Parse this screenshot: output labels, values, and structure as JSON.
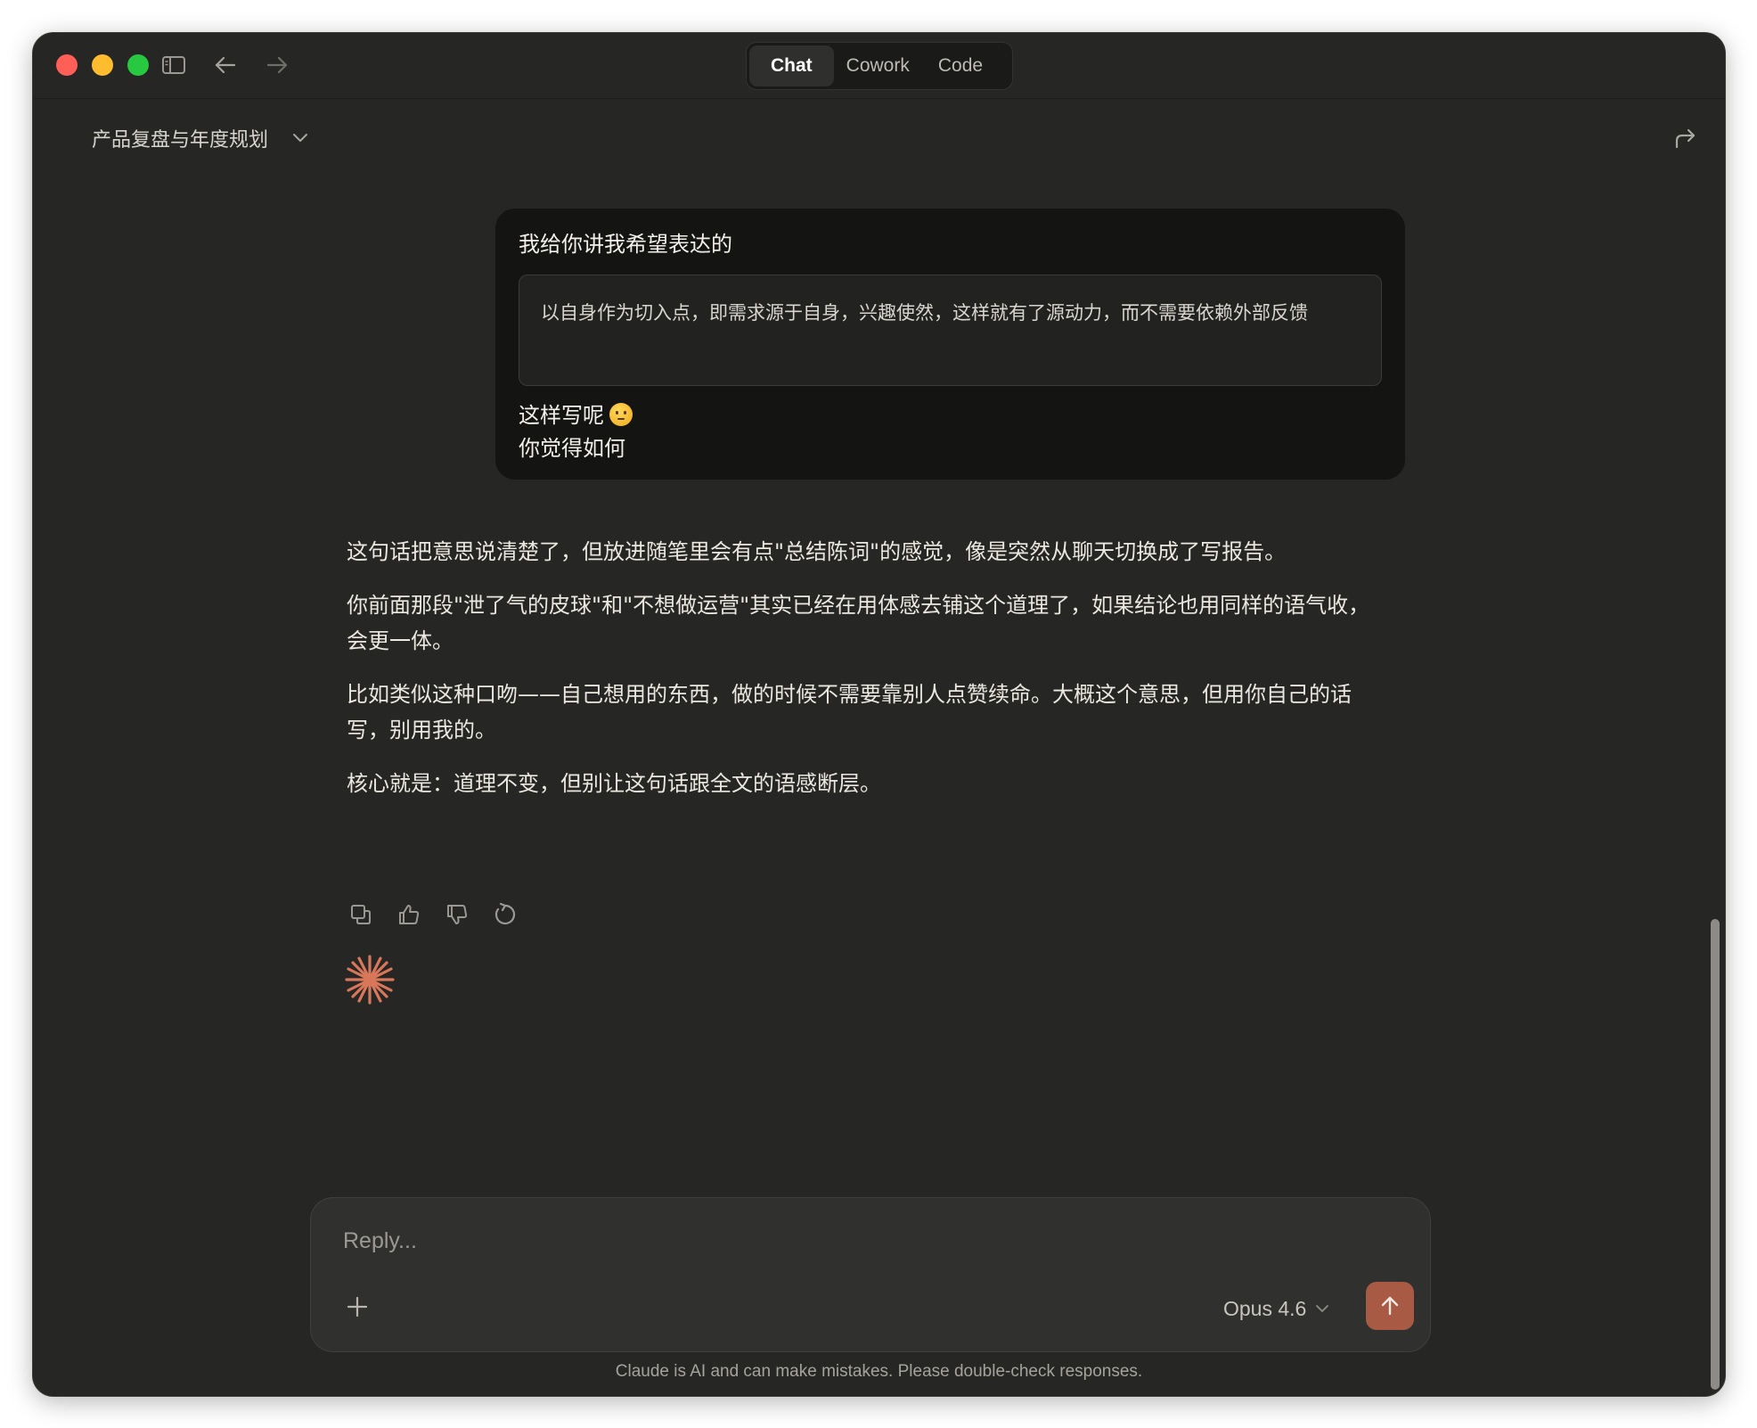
{
  "window": {
    "tabs": [
      {
        "label": "Chat",
        "active": true
      },
      {
        "label": "Cowork",
        "active": false
      },
      {
        "label": "Code",
        "active": false
      }
    ],
    "icons": {
      "sidebar_toggle": "sidebar-toggle-icon",
      "back": "arrow-left-icon",
      "forward": "arrow-right-icon"
    }
  },
  "header": {
    "title": "产品复盘与年度规划",
    "dropdown_icon": "chevron-down-icon",
    "share_icon": "share-icon"
  },
  "user_message": {
    "intro": "我给你讲我希望表达的",
    "quote": "以自身作为切入点，即需求源于自身，兴趣使然，这样就有了源动力，而不需要依赖外部反馈",
    "line1": "这样写呢",
    "emoji": "thinking-face-emoji",
    "line2": "你觉得如何"
  },
  "assistant_message": {
    "paragraphs": [
      "这句话把意思说清楚了，但放进随笔里会有点\"总结陈词\"的感觉，像是突然从聊天切换成了写报告。",
      "你前面那段\"泄了气的皮球\"和\"不想做运营\"其实已经在用体感去铺这个道理了，如果结论也用同样的语气收，会更一体。",
      "比如类似这种口吻——自己想用的东西，做的时候不需要靠别人点赞续命。大概这个意思，但用你自己的话写，别用我的。",
      "核心就是：道理不变，但别让这句话跟全文的语感断层。"
    ],
    "actions": [
      "copy-icon",
      "thumbs-up-icon",
      "thumbs-down-icon",
      "retry-icon"
    ],
    "logo": "claude-spark-icon"
  },
  "composer": {
    "placeholder": "Reply...",
    "value": "",
    "model": "Opus 4.6",
    "add_icon": "plus-icon",
    "send_icon": "arrow-up-icon"
  },
  "footer": {
    "disclaimer": "Claude is AI and can make mistakes. Please double-check responses."
  },
  "colors": {
    "background": "#262624",
    "user_bubble": "#141413",
    "accent": "#a85a45",
    "spark": "#d9775a"
  }
}
